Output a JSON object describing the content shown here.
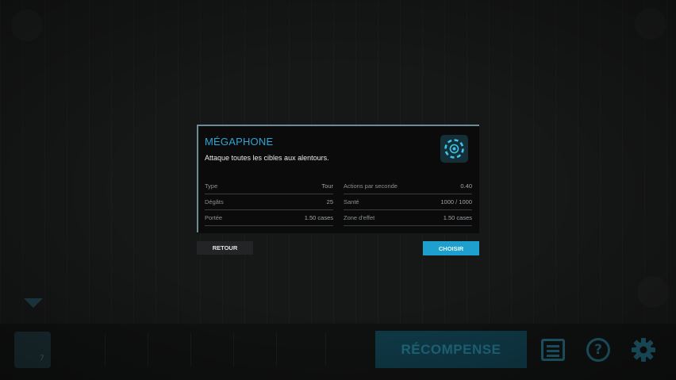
{
  "modal": {
    "title": "MÉGAPHONE",
    "description": "Attaque toutes les cibles aux alentours.",
    "icon": "megaphone-tower-icon",
    "accent_color": "#2aa7d2",
    "stats_left": [
      {
        "label": "Type",
        "value": "Tour"
      },
      {
        "label": "Dégâts",
        "value": "25"
      },
      {
        "label": "Portée",
        "value": "1.50 cases"
      }
    ],
    "stats_right": [
      {
        "label": "Actions par seconde",
        "value": "0.40"
      },
      {
        "label": "Santé",
        "value": "1000 / 1000"
      },
      {
        "label": "Zone d'effet",
        "value": "1.50 cases"
      }
    ],
    "back_label": "RETOUR",
    "choose_label": "CHOISIR",
    "choose_color": "#1ea0cf"
  },
  "hud": {
    "reward_label": "RÉCOMPENSE",
    "slot_count": "7",
    "icons": [
      "list-icon",
      "help-icon",
      "settings-gear-icon"
    ]
  }
}
